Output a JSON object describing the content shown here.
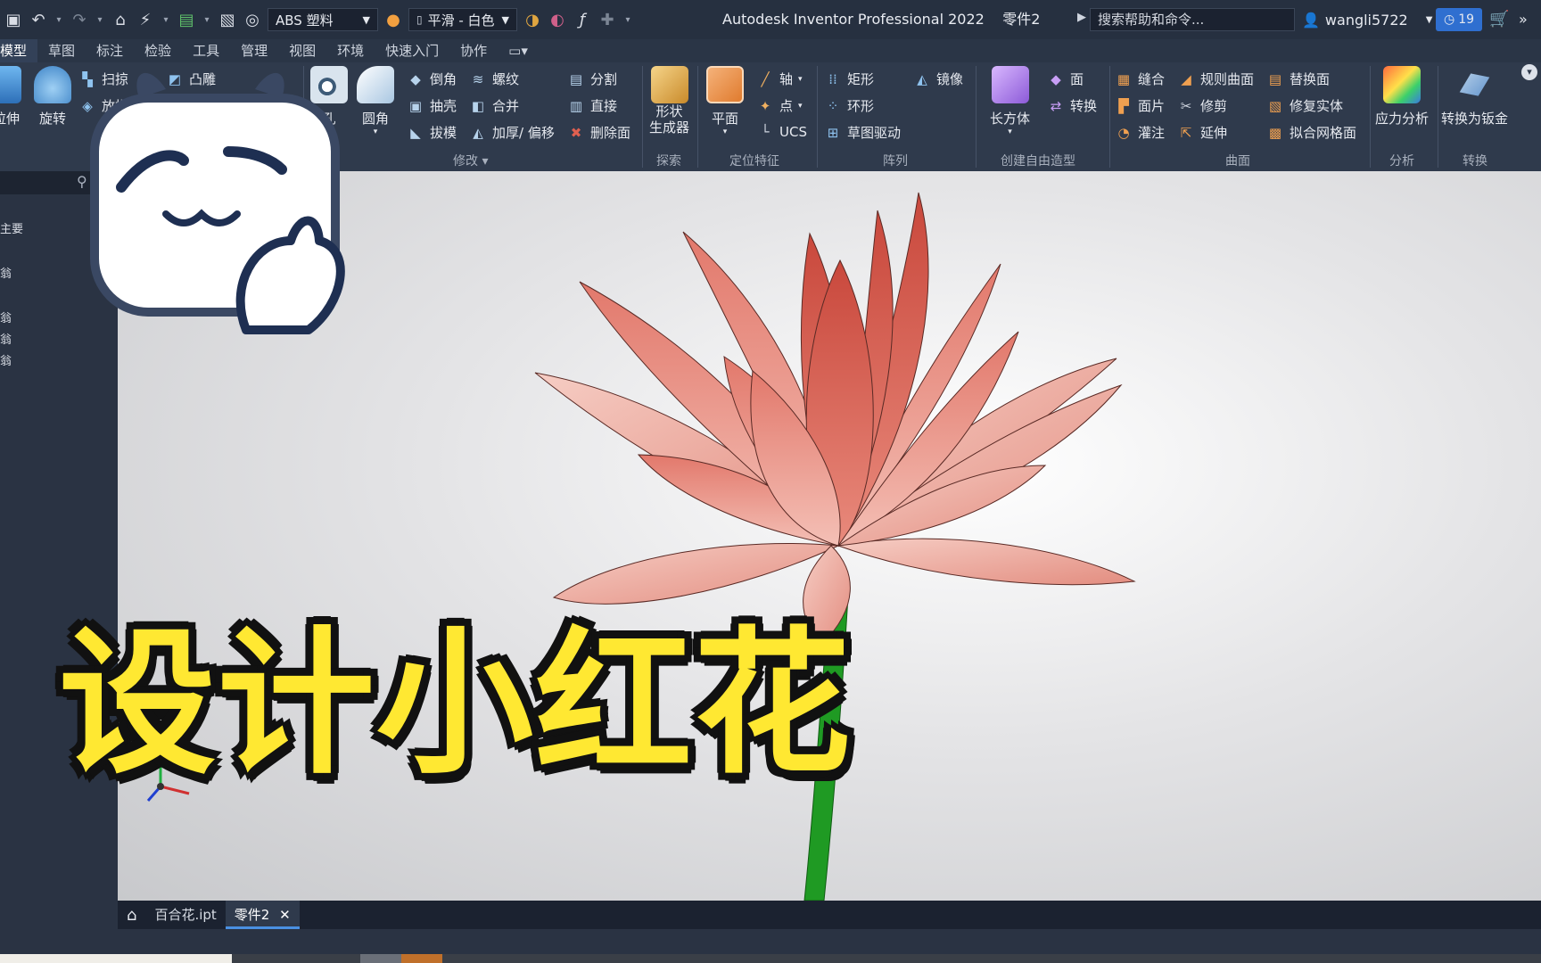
{
  "app": {
    "window_title": "Autodesk Inventor Professional 2022",
    "document_name": "零件2",
    "help_search_placeholder": "搜索帮助和命令...",
    "username": "wangli5722",
    "notification_count": "19"
  },
  "quick_access": {
    "material": "ABS 塑料",
    "appearance": "平滑 - 白色"
  },
  "ribbon_tabs": [
    "模型",
    "草图",
    "标注",
    "检验",
    "工具",
    "管理",
    "视图",
    "环境",
    "快速入门",
    "协作"
  ],
  "ribbon_tab_active": "模型",
  "ribbon": {
    "create": {
      "extrude": "拉伸",
      "revolve": "旋转",
      "sweep": "扫掠",
      "loft": "放样",
      "emboss": "凸雕"
    },
    "modify": {
      "hole": "孔",
      "fillet": "圆角",
      "chamfer": "倒角",
      "shell": "抽壳",
      "draft": "拔模",
      "thread": "螺纹",
      "combine": "合并",
      "thicken": "加厚/ 偏移",
      "split": "分割",
      "direct": "直接",
      "delete_face": "删除面",
      "panel": "修改"
    },
    "explore": {
      "shape_gen": "形状\n生成器",
      "panel": "探索"
    },
    "work_features": {
      "plane": "平面",
      "axis": "轴",
      "point": "点",
      "ucs": "UCS",
      "panel": "定位特征"
    },
    "pattern": {
      "rect": "矩形",
      "circ": "环形",
      "sketch_driven": "草图驱动",
      "mirror": "镜像",
      "panel": "阵列"
    },
    "freeform": {
      "box": "长方体",
      "face": "面",
      "convert": "转换",
      "panel": "创建自由造型"
    },
    "surface": {
      "stitch": "缝合",
      "patch": "面片",
      "sculpt": "灌注",
      "ruled": "规则曲面",
      "trim": "修剪",
      "extend": "延伸",
      "replace_face": "替换面",
      "repair": "修复实体",
      "fit_mesh": "拟合网格面",
      "panel": "曲面"
    },
    "simulation": {
      "stress": "应力分析",
      "panel": "分析"
    },
    "convert": {
      "sheet_metal": "转换为钣金",
      "panel": "转换"
    }
  },
  "browser": {
    "items": [
      "主要",
      "翁",
      "翁",
      "翁",
      "翁"
    ]
  },
  "doc_tabs": [
    "百合花.ipt",
    "零件2"
  ],
  "doc_tab_active": "零件2",
  "overlay_title": "设计小红花",
  "colors": {
    "petal": "#e58e82",
    "petal_light": "#f6c9c0",
    "stem": "#1f9a23",
    "overlay_yellow": "#ffe832",
    "accent_blue": "#2f6fd0"
  }
}
